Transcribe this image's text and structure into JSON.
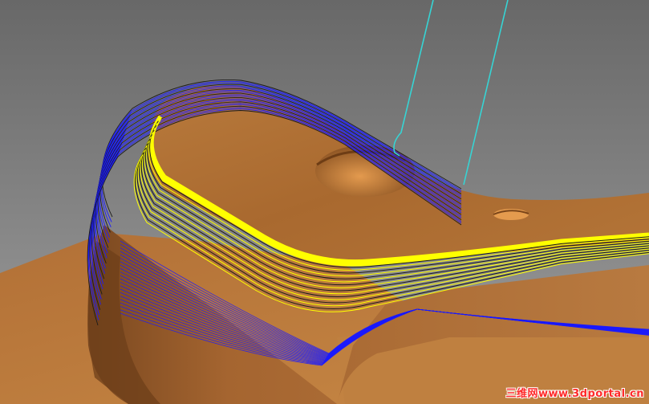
{
  "scene": {
    "description_name": "cam-toolpath-viewport",
    "colors": {
      "background_top": "#6c6c6c",
      "background_bottom": "#9a9a9a",
      "part_light": "#c98a45",
      "part_mid": "#a8692f",
      "part_dark": "#7d4a1d",
      "toolpath_blue": "#1a1aff",
      "toolpath_yellow": "#ffff00",
      "toolpath_dark": "#1c1c1c",
      "tool_outline": "#33d6d6"
    },
    "icons": [
      "cutting-tool-icon"
    ]
  },
  "watermark": {
    "text": "三维网www.3dportal.cn"
  }
}
